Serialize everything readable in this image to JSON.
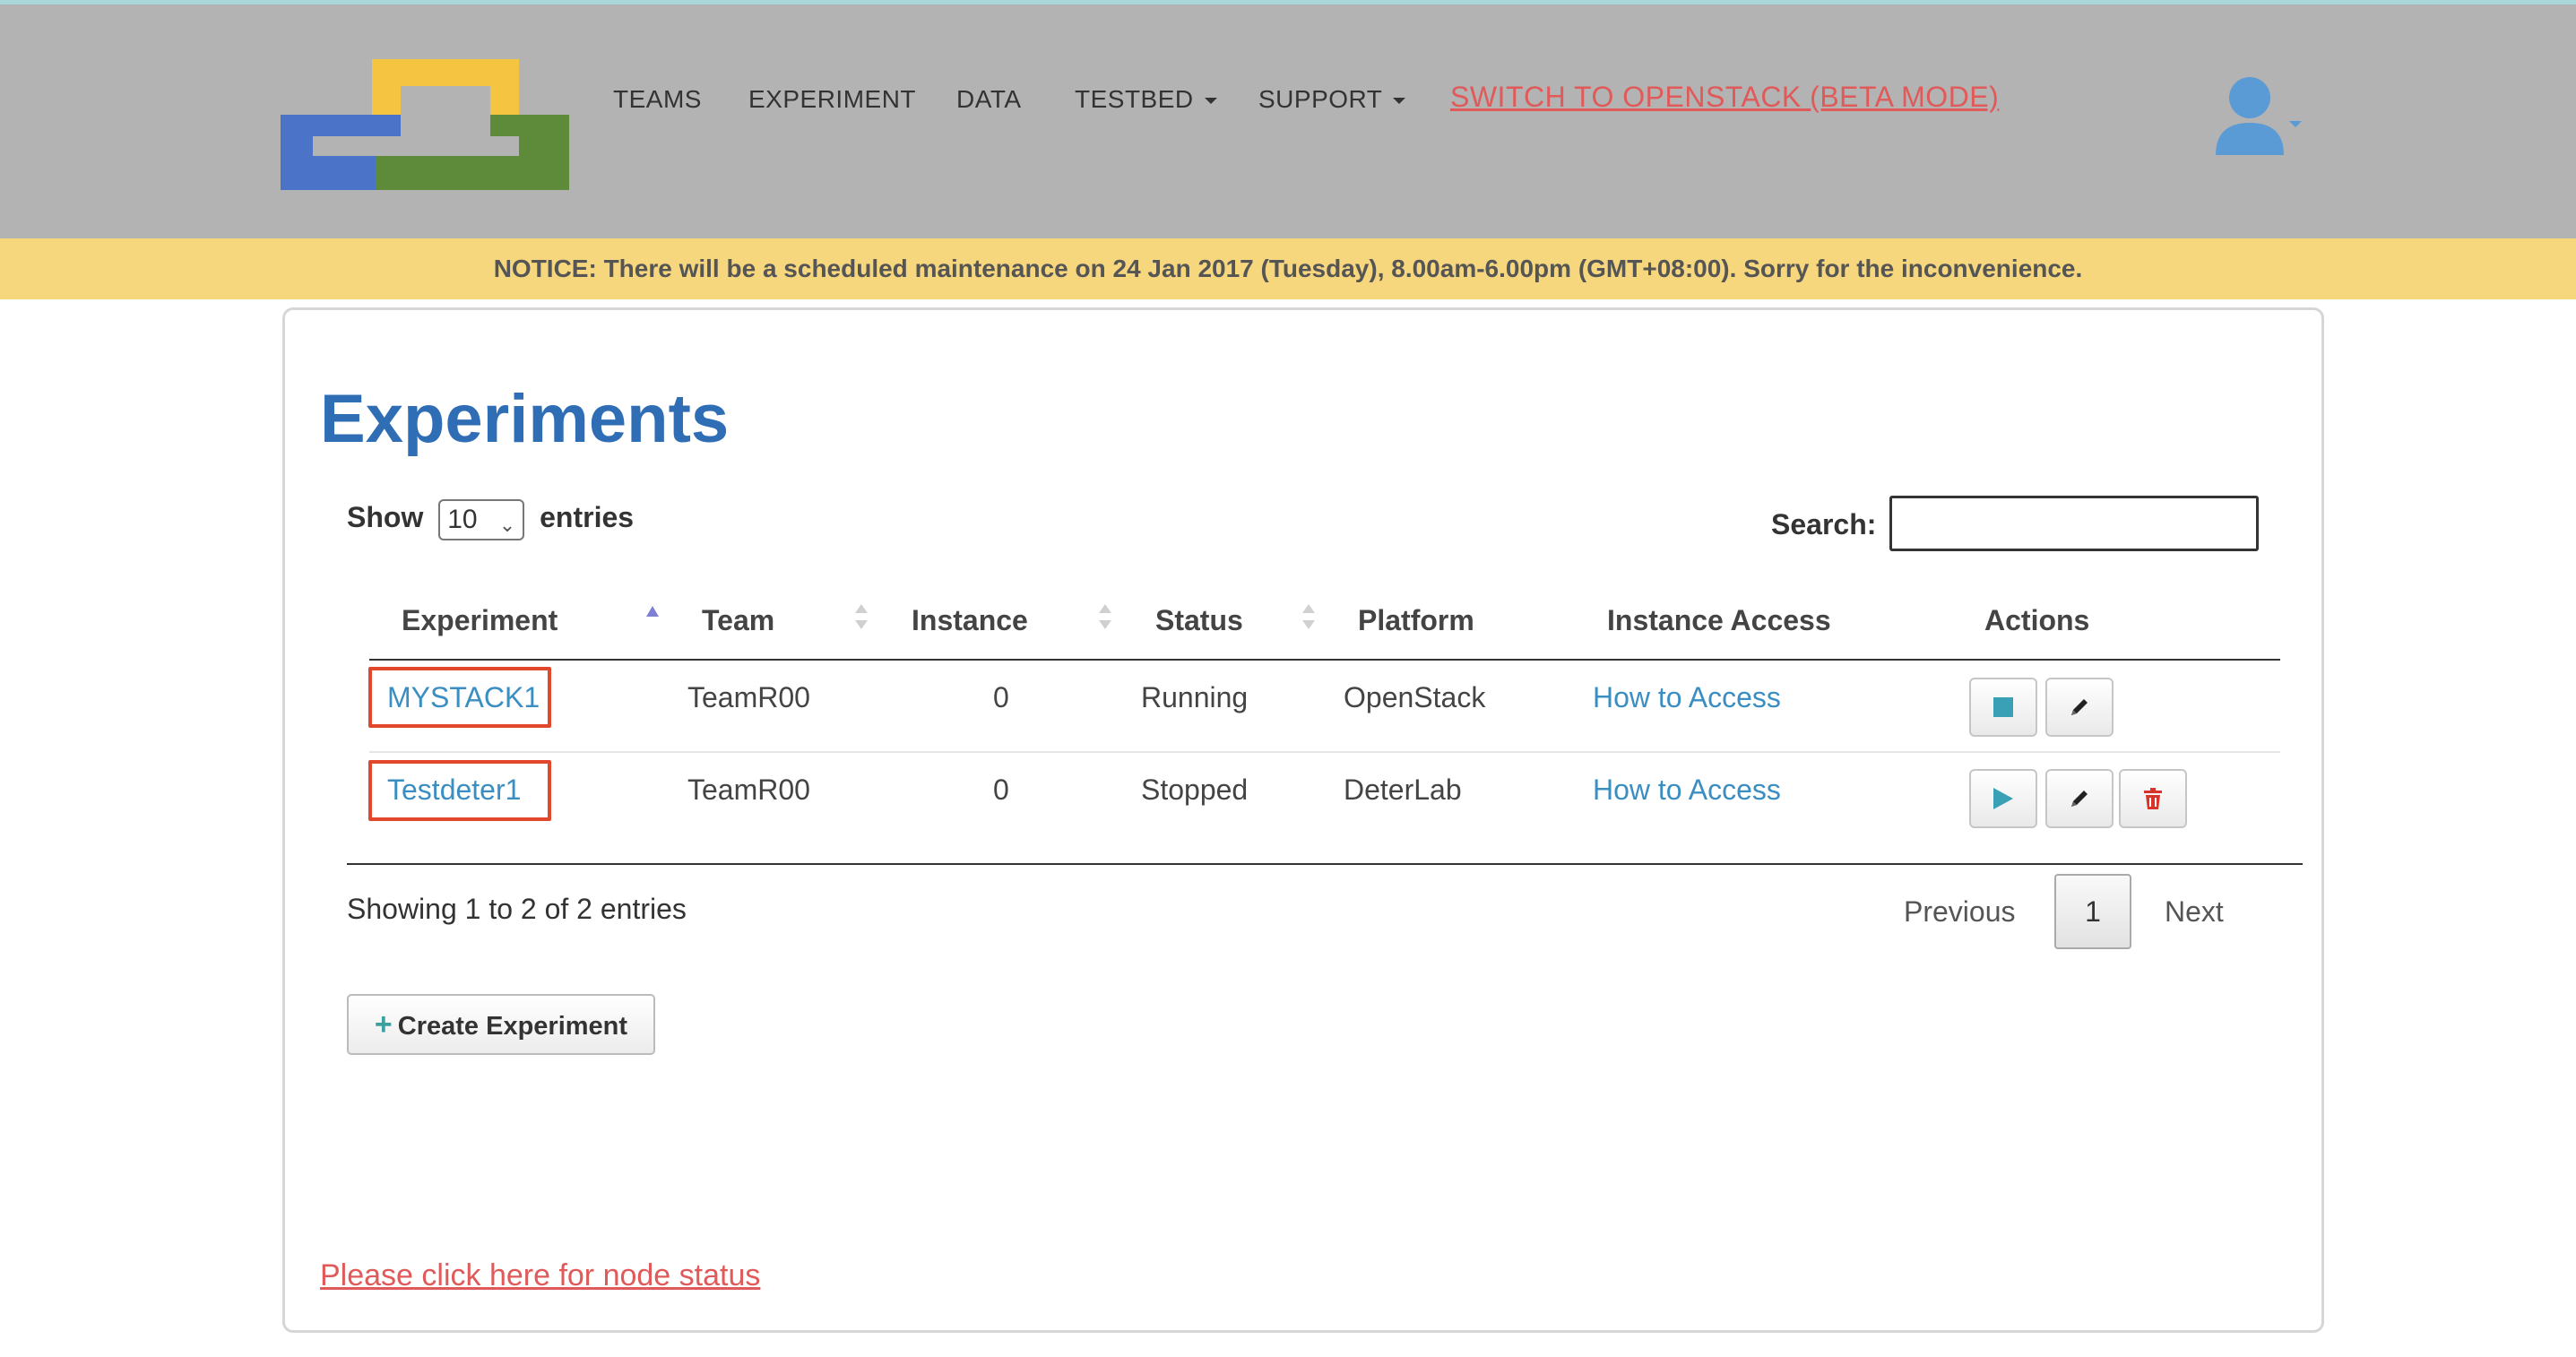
{
  "nav": {
    "items": [
      {
        "label": "TEAMS"
      },
      {
        "label": "EXPERIMENT"
      },
      {
        "label": "DATA"
      },
      {
        "label": "TESTBED"
      },
      {
        "label": "SUPPORT"
      }
    ],
    "switch_label": "SWITCH TO OPENSTACK (BETA MODE)",
    "user_icon": "user-avatar-icon"
  },
  "notice": {
    "text": "NOTICE: There will be a scheduled maintenance on 24 Jan 2017 (Tuesday), 8.00am-6.00pm (GMT+08:00). Sorry for the inconvenience."
  },
  "main": {
    "title": "Experiments",
    "show_label": "Show",
    "entries_value": "10",
    "entries_label": "entries",
    "search_label": "Search:",
    "search_value": "",
    "columns": [
      "Experiment",
      "Team",
      "Instance",
      "Status",
      "Platform",
      "Instance Access",
      "Actions"
    ],
    "rows": [
      {
        "experiment": "MYSTACK1",
        "team": "TeamR00",
        "instance": "0",
        "status": "Running",
        "platform": "OpenStack",
        "access": "How to Access",
        "actions": [
          "stop",
          "edit"
        ]
      },
      {
        "experiment": "Testdeter1",
        "team": "TeamR00",
        "instance": "0",
        "status": "Stopped",
        "platform": "DeterLab",
        "access": "How to Access",
        "actions": [
          "start",
          "edit",
          "delete"
        ]
      }
    ],
    "showing": "Showing 1 to 2 of 2 entries",
    "pagination": {
      "previous": "Previous",
      "page": "1",
      "next": "Next"
    },
    "create_button": "Create Experiment",
    "node_status_link": "Please click here for node status"
  },
  "colors": {
    "navbar": "#b3b3b3",
    "notice": "#f7d77d",
    "title": "#2f6db5",
    "link": "#3b8ec2",
    "alert_link": "#e05a5a",
    "highlight_box": "#e0472c"
  }
}
